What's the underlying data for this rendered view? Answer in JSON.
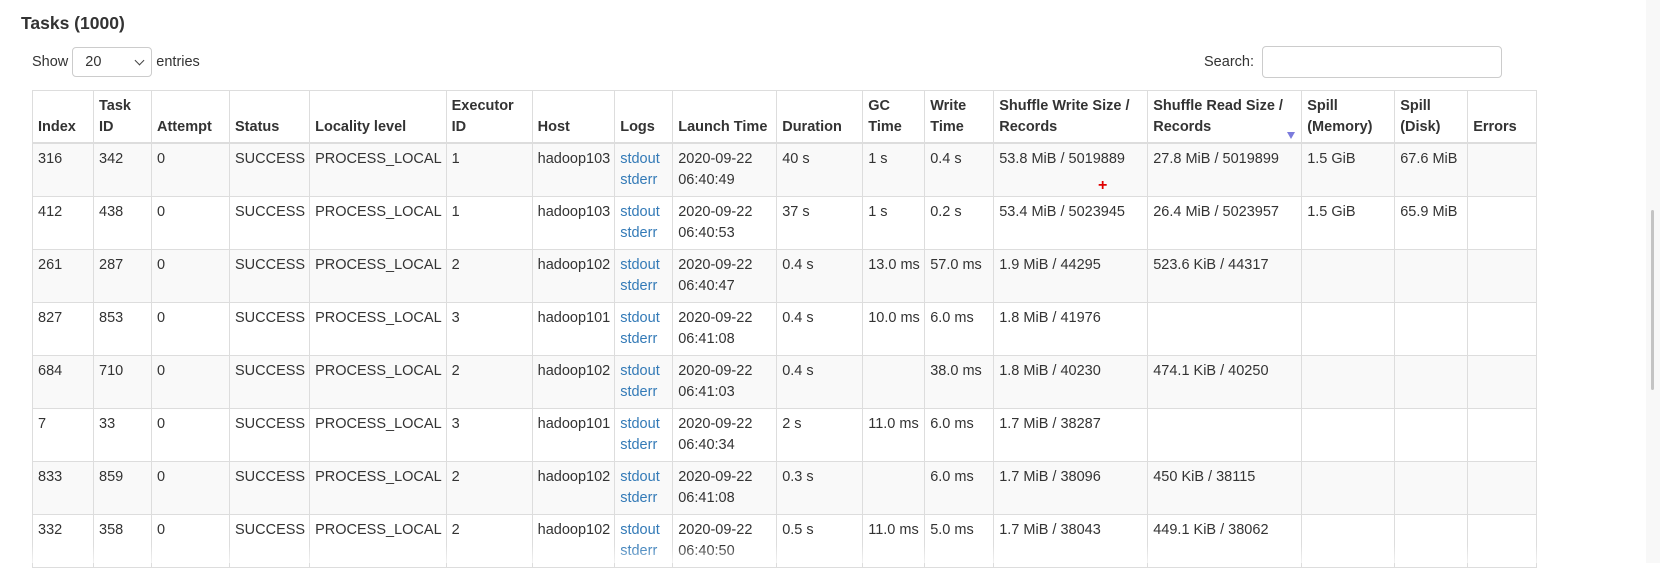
{
  "title": "Tasks (1000)",
  "length_menu": {
    "show_label": "Show",
    "selected": "20",
    "entries_label": "entries"
  },
  "search": {
    "label": "Search:",
    "value": "",
    "placeholder": ""
  },
  "colors": {
    "link": "#337ab7",
    "sort_indicator": "#7b7bdc",
    "row_stripe": "#f9f9f9",
    "border": "#dddddd"
  },
  "table": {
    "columns": [
      "Index",
      "Task ID",
      "Attempt",
      "Status",
      "Locality level",
      "Executor ID",
      "Host",
      "Logs",
      "Launch Time",
      "Duration",
      "GC Time",
      "Write Time",
      "Shuffle Write Size / Records",
      "Shuffle Read Size / Records",
      "Spill (Memory)",
      "Spill (Disk)",
      "Errors"
    ],
    "sorted_column": "Shuffle Read Size / Records",
    "sort_direction": "descending",
    "log_links": [
      "stdout",
      "stderr"
    ],
    "rows": [
      {
        "index": "316",
        "task_id": "342",
        "attempt": "0",
        "status": "SUCCESS",
        "locality": "PROCESS_LOCAL",
        "executor": "1",
        "host": "hadoop103",
        "launch_date": "2020-09-22",
        "launch_time": "06:40:49",
        "duration": "40 s",
        "gc_time": "1 s",
        "write_time": "0.4 s",
        "shuffle_write": "53.8 MiB / 5019889",
        "shuffle_read": "27.8 MiB / 5019899",
        "spill_memory": "1.5 GiB",
        "spill_disk": "67.6 MiB",
        "errors": ""
      },
      {
        "index": "412",
        "task_id": "438",
        "attempt": "0",
        "status": "SUCCESS",
        "locality": "PROCESS_LOCAL",
        "executor": "1",
        "host": "hadoop103",
        "launch_date": "2020-09-22",
        "launch_time": "06:40:53",
        "duration": "37 s",
        "gc_time": "1 s",
        "write_time": "0.2 s",
        "shuffle_write": "53.4 MiB / 5023945",
        "shuffle_read": "26.4 MiB / 5023957",
        "spill_memory": "1.5 GiB",
        "spill_disk": "65.9 MiB",
        "errors": ""
      },
      {
        "index": "261",
        "task_id": "287",
        "attempt": "0",
        "status": "SUCCESS",
        "locality": "PROCESS_LOCAL",
        "executor": "2",
        "host": "hadoop102",
        "launch_date": "2020-09-22",
        "launch_time": "06:40:47",
        "duration": "0.4 s",
        "gc_time": "13.0 ms",
        "write_time": "57.0 ms",
        "shuffle_write": "1.9 MiB / 44295",
        "shuffle_read": "523.6 KiB / 44317",
        "spill_memory": "",
        "spill_disk": "",
        "errors": ""
      },
      {
        "index": "827",
        "task_id": "853",
        "attempt": "0",
        "status": "SUCCESS",
        "locality": "PROCESS_LOCAL",
        "executor": "3",
        "host": "hadoop101",
        "launch_date": "2020-09-22",
        "launch_time": "06:41:08",
        "duration": "0.4 s",
        "gc_time": "10.0 ms",
        "write_time": "6.0 ms",
        "shuffle_write": "1.8 MiB / 41976",
        "shuffle_read": "",
        "spill_memory": "",
        "spill_disk": "",
        "errors": ""
      },
      {
        "index": "684",
        "task_id": "710",
        "attempt": "0",
        "status": "SUCCESS",
        "locality": "PROCESS_LOCAL",
        "executor": "2",
        "host": "hadoop102",
        "launch_date": "2020-09-22",
        "launch_time": "06:41:03",
        "duration": "0.4 s",
        "gc_time": "",
        "write_time": "38.0 ms",
        "shuffle_write": "1.8 MiB / 40230",
        "shuffle_read": "474.1 KiB / 40250",
        "spill_memory": "",
        "spill_disk": "",
        "errors": ""
      },
      {
        "index": "7",
        "task_id": "33",
        "attempt": "0",
        "status": "SUCCESS",
        "locality": "PROCESS_LOCAL",
        "executor": "3",
        "host": "hadoop101",
        "launch_date": "2020-09-22",
        "launch_time": "06:40:34",
        "duration": "2 s",
        "gc_time": "11.0 ms",
        "write_time": "6.0 ms",
        "shuffle_write": "1.7 MiB / 38287",
        "shuffle_read": "",
        "spill_memory": "",
        "spill_disk": "",
        "errors": ""
      },
      {
        "index": "833",
        "task_id": "859",
        "attempt": "0",
        "status": "SUCCESS",
        "locality": "PROCESS_LOCAL",
        "executor": "2",
        "host": "hadoop102",
        "launch_date": "2020-09-22",
        "launch_time": "06:41:08",
        "duration": "0.3 s",
        "gc_time": "",
        "write_time": "6.0 ms",
        "shuffle_write": "1.7 MiB / 38096",
        "shuffle_read": "450 KiB / 38115",
        "spill_memory": "",
        "spill_disk": "",
        "errors": ""
      },
      {
        "index": "332",
        "task_id": "358",
        "attempt": "0",
        "status": "SUCCESS",
        "locality": "PROCESS_LOCAL",
        "executor": "2",
        "host": "hadoop102",
        "launch_date": "2020-09-22",
        "launch_time": "06:40:50",
        "duration": "0.5 s",
        "gc_time": "11.0 ms",
        "write_time": "5.0 ms",
        "shuffle_write": "1.7 MiB / 38043",
        "shuffle_read": "449.1 KiB / 38062",
        "spill_memory": "",
        "spill_disk": "",
        "errors": ""
      }
    ]
  }
}
